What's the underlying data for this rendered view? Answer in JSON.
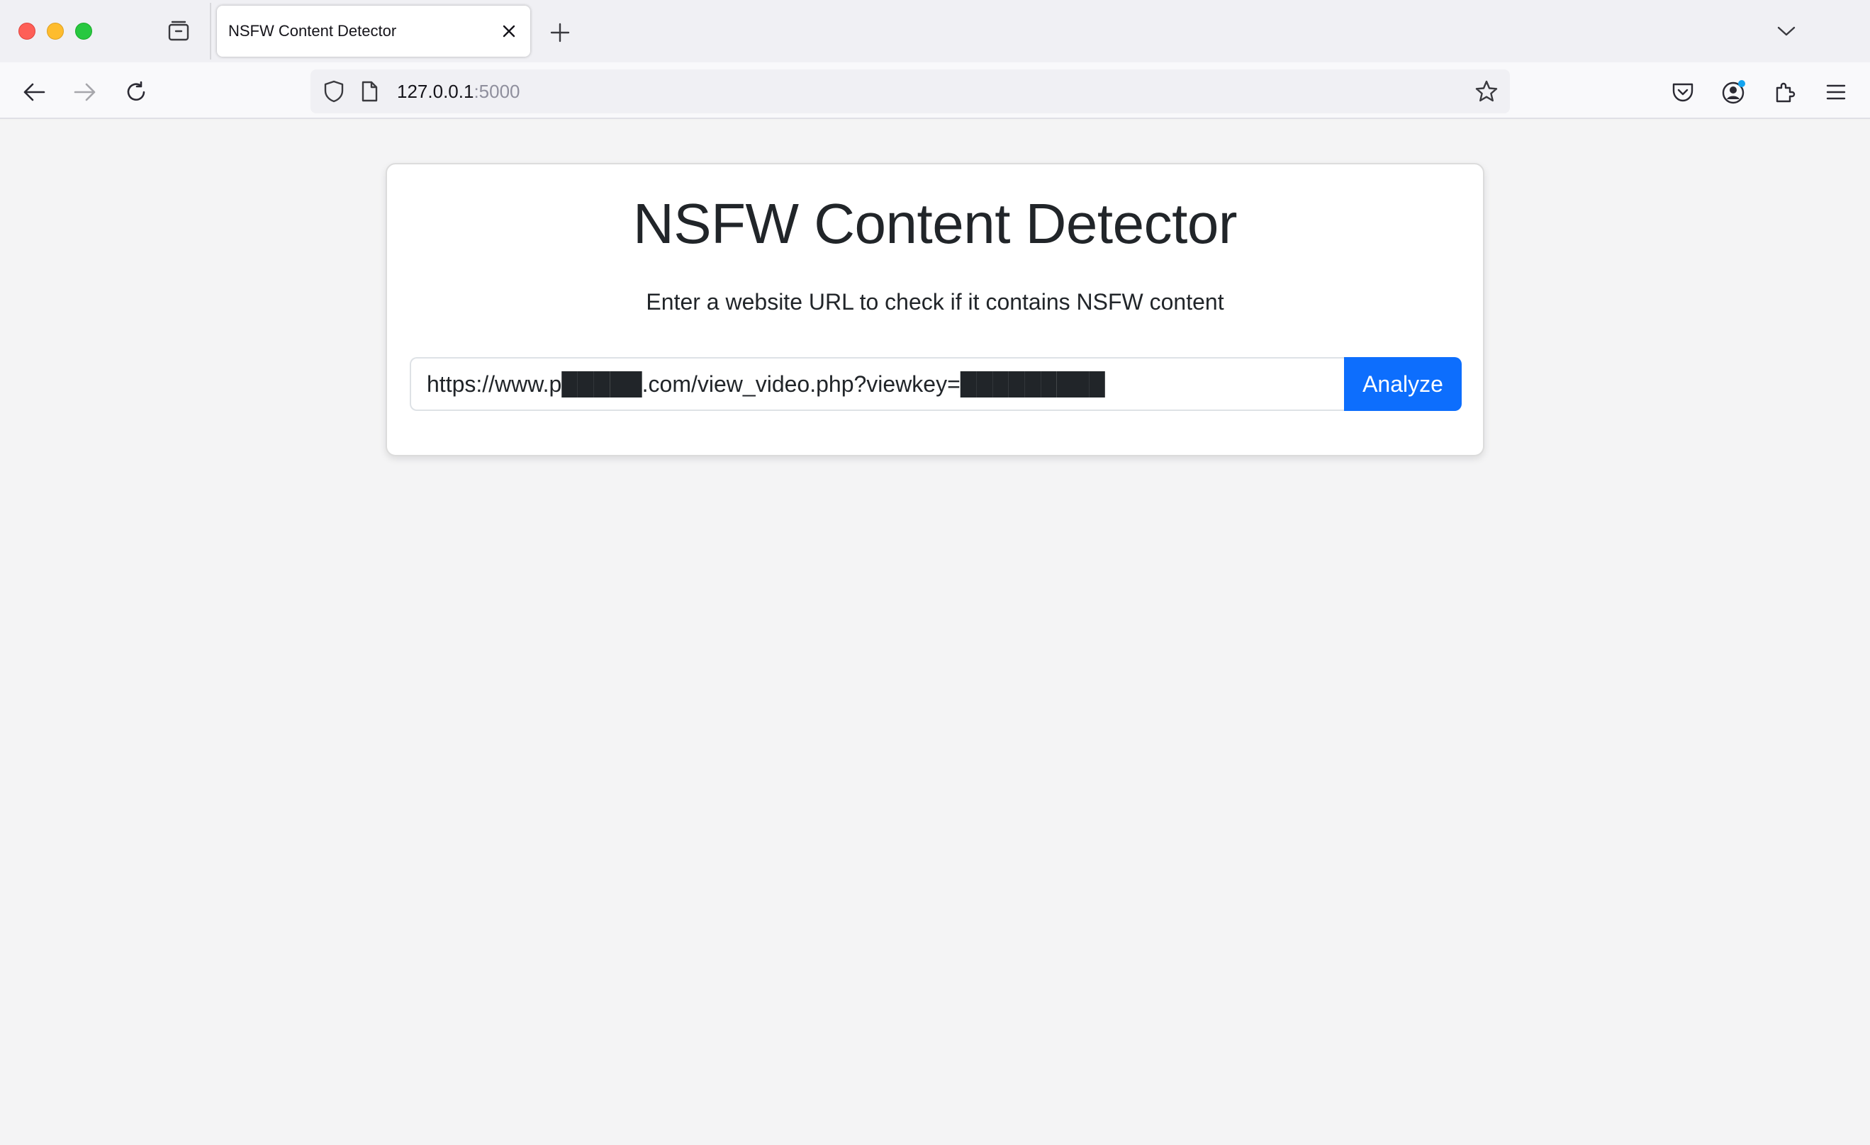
{
  "browser": {
    "tab": {
      "title": "NSFW Content Detector",
      "close_icon": "close-icon"
    },
    "icons": {
      "tab_list": "tab-list-icon",
      "new_tab": "plus-icon",
      "tab_overflow": "chevron-down-icon",
      "back": "arrow-left-icon",
      "forward": "arrow-right-icon",
      "reload": "reload-icon",
      "shield": "shield-icon",
      "page": "page-icon",
      "bookmark": "star-icon",
      "pocket": "pocket-icon",
      "account": "account-icon",
      "extensions": "puzzle-icon",
      "menu": "hamburger-menu-icon"
    },
    "url": {
      "host": "127.0.0.1",
      "port": ":5000"
    }
  },
  "page": {
    "title": "NSFW Content Detector",
    "subtitle": "Enter a website URL to check if it contains NSFW content",
    "url_input_value": "https://www.p█████.com/view_video.php?viewkey=█████████",
    "analyze_label": "Analyze"
  },
  "colors": {
    "accent": "#0d6efd",
    "text": "#212529",
    "page_bg": "#f4f4f5"
  }
}
